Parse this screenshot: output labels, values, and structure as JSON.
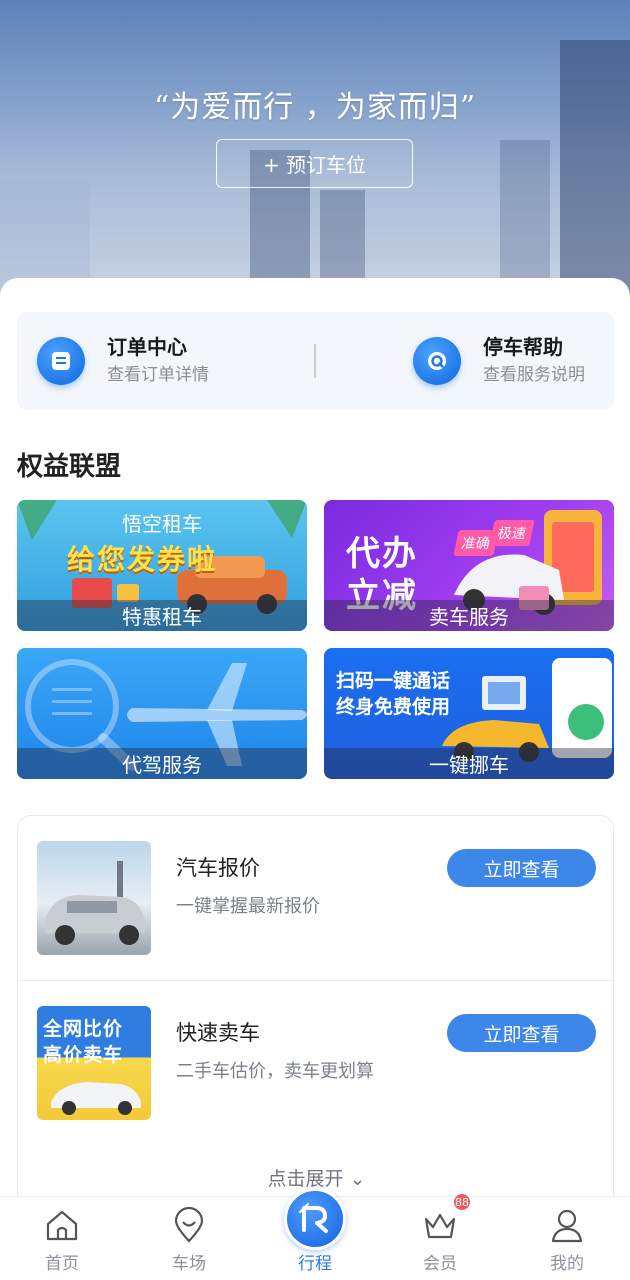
{
  "hero": {
    "slogan": "“为爱而行 ，为家而归”",
    "book_button": "+ 预订车位"
  },
  "quick_links": [
    {
      "title": "订单中心",
      "subtitle": "查看订单详情",
      "icon": "order-list-icon"
    },
    {
      "title": "停车帮助",
      "subtitle": "查看服务说明",
      "icon": "help-chat-icon"
    }
  ],
  "benefits": {
    "title": "权益联盟",
    "cards": [
      {
        "caption": "特惠租车",
        "headline": "悟空租车",
        "banner": "给您发券啦"
      },
      {
        "caption": "卖车服务",
        "line1": "代办",
        "line2": "立减",
        "tag1": "准确",
        "tag2": "极速"
      },
      {
        "caption": "代驾服务"
      },
      {
        "caption": "一键挪车",
        "line1": "扫码一键通话",
        "line2": "终身免费使用"
      }
    ]
  },
  "list": {
    "items": [
      {
        "title": "汽车报价",
        "subtitle": "一键掌握最新报价",
        "button": "立即查看"
      },
      {
        "title": "快速卖车",
        "subtitle": "二手车估价，卖车更划算",
        "button": "立即查看",
        "thumb_line1": "全网比价",
        "thumb_line2": "高价卖车"
      }
    ],
    "expand_label": "点击展开 ⌄"
  },
  "tabbar": {
    "tabs": [
      {
        "label": "首页",
        "icon": "home-icon"
      },
      {
        "label": "车场",
        "icon": "location-pin-icon"
      },
      {
        "label": "行程",
        "icon": "trip-icon",
        "active": true
      },
      {
        "label": "会员",
        "icon": "crown-icon",
        "badge": "88"
      },
      {
        "label": "我的",
        "icon": "user-icon"
      }
    ]
  },
  "colors": {
    "accent": "#3d86ea",
    "tab_active": "#2f7ae6",
    "badge": "#f25a5a"
  }
}
